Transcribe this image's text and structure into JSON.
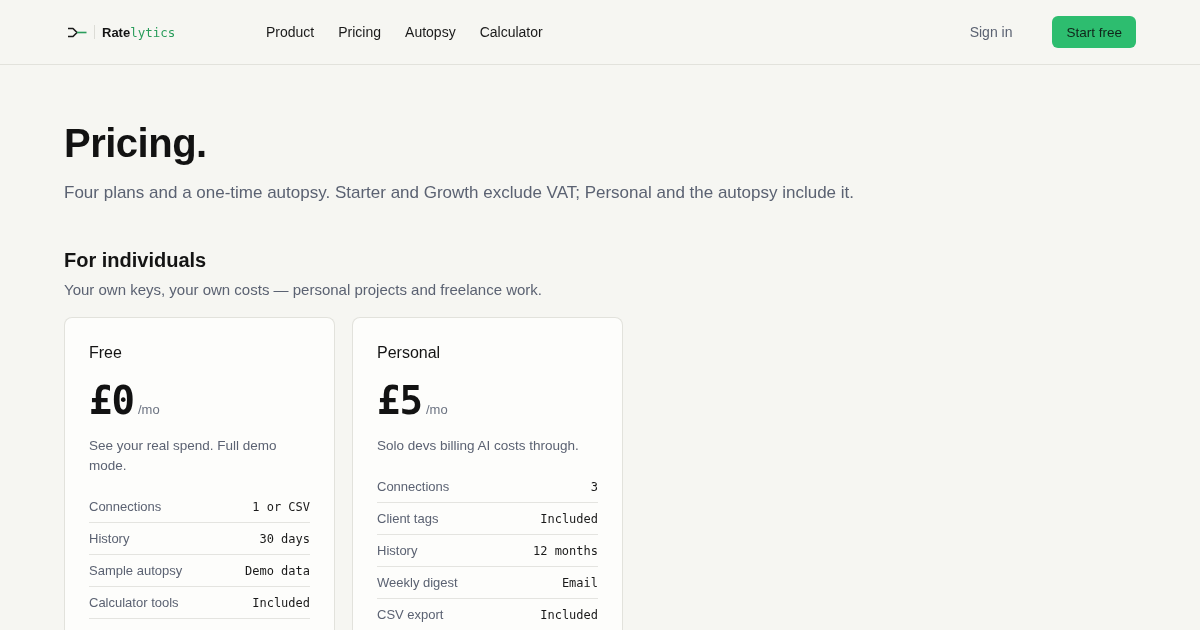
{
  "header": {
    "brand": {
      "name_start": "Rate",
      "name_end": "lytics"
    },
    "nav_links": [
      "Product",
      "Pricing",
      "Autopsy",
      "Calculator"
    ],
    "sign_in": "Sign in",
    "cta": "Start free"
  },
  "hero": {
    "title": "Pricing.",
    "subtitle": "Four plans and a one-time autopsy. Starter and Growth exclude VAT; Personal and the autopsy include it."
  },
  "section": {
    "title": "For individuals",
    "description": "Your own keys, your own costs — personal projects and freelance work.",
    "plans": [
      {
        "name": "Free",
        "price": "£0",
        "period": "/mo",
        "description": "See your real spend. Full demo mode.",
        "features": [
          {
            "label": "Connections",
            "value": "1 or CSV"
          },
          {
            "label": "History",
            "value": "30 days"
          },
          {
            "label": "Sample autopsy",
            "value": "Demo data"
          },
          {
            "label": "Calculator tools",
            "value": "Included"
          }
        ]
      },
      {
        "name": "Personal",
        "price": "£5",
        "period": "/mo",
        "description": "Solo devs billing AI costs through.",
        "features": [
          {
            "label": "Connections",
            "value": "3"
          },
          {
            "label": "Client tags",
            "value": "Included"
          },
          {
            "label": "History",
            "value": "12 months"
          },
          {
            "label": "Weekly digest",
            "value": "Email"
          },
          {
            "label": "CSV export",
            "value": "Included"
          }
        ]
      }
    ]
  }
}
